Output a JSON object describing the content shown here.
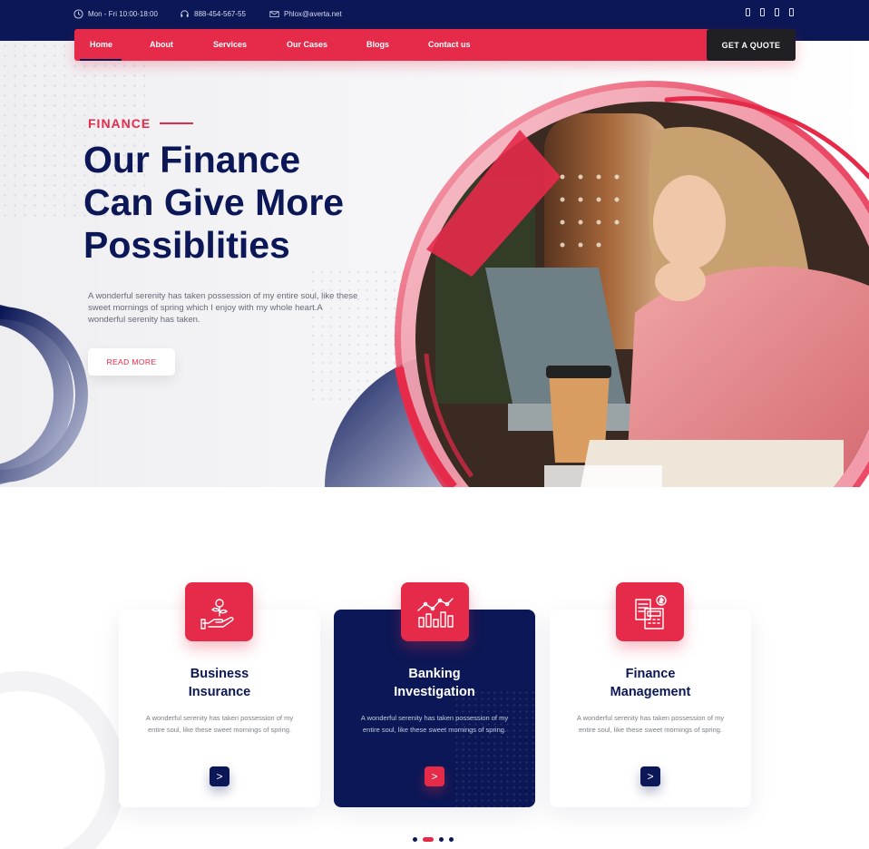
{
  "topbar": {
    "hours": "Mon - Fri 10:00-18:00",
    "phone": "888-454-567-55",
    "email": "Phlox@averta.net",
    "social_icons": [
      "facebook-icon",
      "twitter-icon",
      "instagram-icon",
      "linkedin-icon"
    ]
  },
  "nav": {
    "items": [
      "Home",
      "About",
      "Services",
      "Our Cases",
      "Blogs",
      "Contact us"
    ],
    "active": "Home",
    "cta": "GET A QUOTE"
  },
  "hero": {
    "eyebrow": "FINANCE",
    "headline": [
      "Our Finance",
      "Can Give More",
      "Possiblities"
    ],
    "lead": "A wonderful serenity has taken possession of my entire soul, like these sweet mornings of spring which I enjoy with my whole heart.A wonderful serenity has taken.",
    "button": "READ MORE"
  },
  "services": [
    {
      "title_line1": "Business",
      "title_line2": "Insurance",
      "text": "A wonderful serenity has taken possession of my entire soul, like these sweet mornings of spring.",
      "arrow": ">",
      "icon": "hand-plant-icon"
    },
    {
      "title_line1": "Banking",
      "title_line2": "Investigation",
      "text": "A wonderful serenity has taken possession of my entire soul, like these sweet mornings of spring.",
      "arrow": ">",
      "icon": "bar-chart-icon"
    },
    {
      "title_line1": "Finance",
      "title_line2": "Management",
      "text": "A wonderful serenity has taken possession of my entire soul, like these sweet mornings of spring.",
      "arrow": ">",
      "icon": "calculator-icon"
    }
  ],
  "colors": {
    "navy": "#0b1756",
    "accent": "#e62a4a",
    "dark_button": "#1f1f24"
  }
}
